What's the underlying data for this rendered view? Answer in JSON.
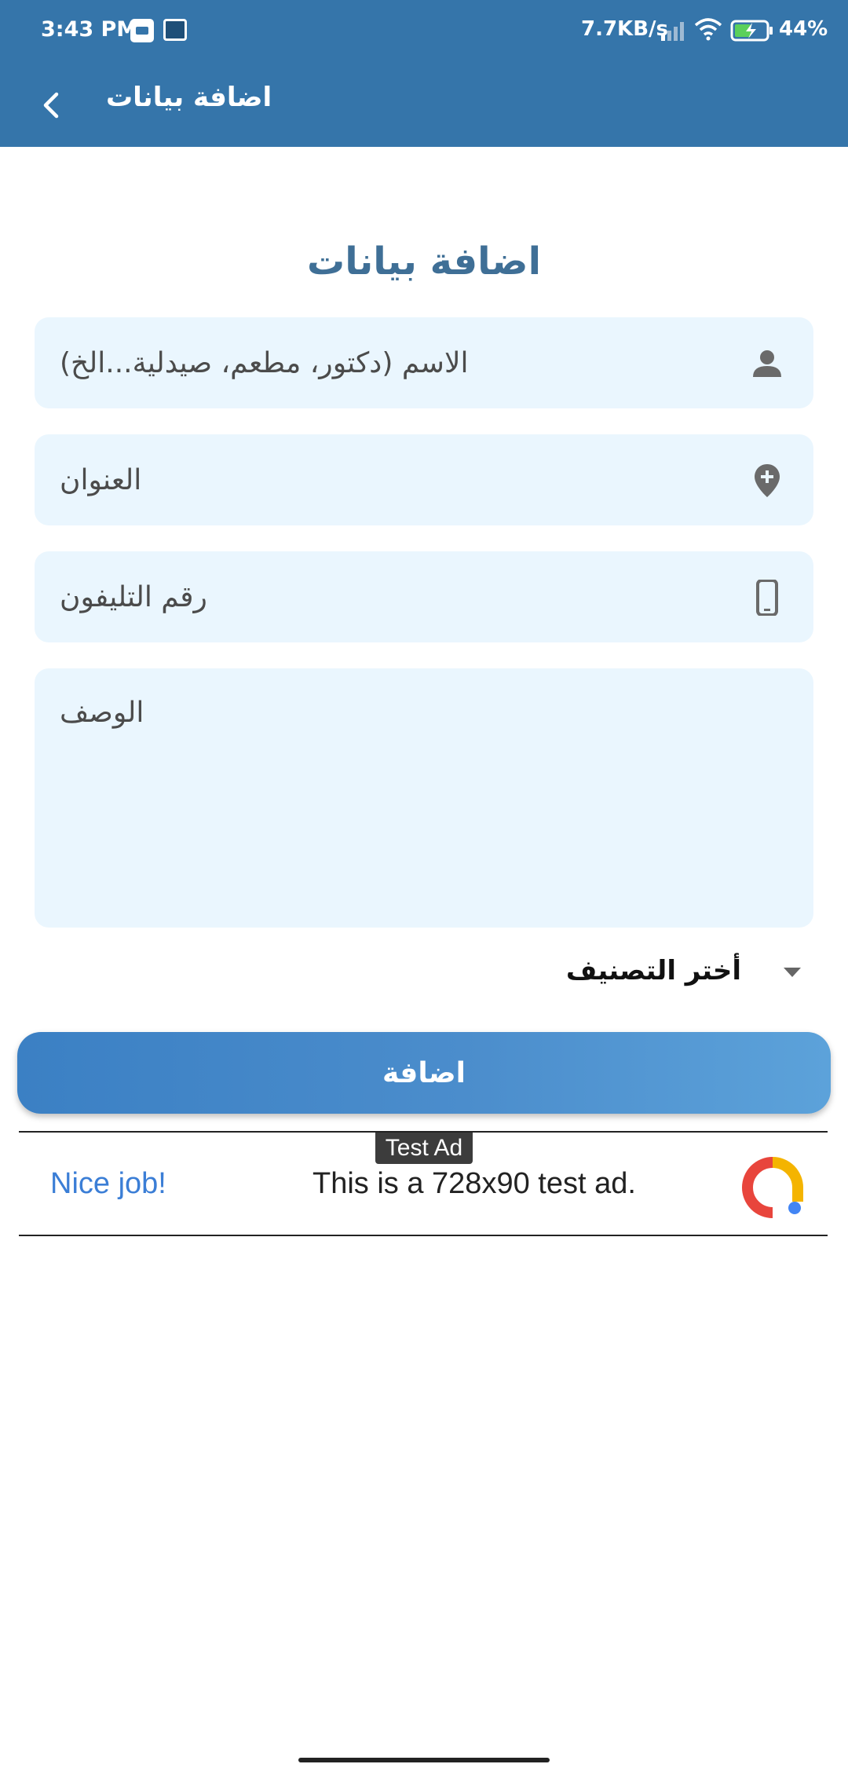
{
  "status_bar": {
    "time": "3:43 PM",
    "speed": "7.7KB/s",
    "battery": "44%",
    "icons": [
      "notification-app-icon",
      "notification-tv-icon",
      "signal-icon",
      "wifi-icon",
      "battery-icon"
    ]
  },
  "app_bar": {
    "title": "اضافة بيانات",
    "back_icon": "chevron-left-icon"
  },
  "form": {
    "title": "اضافة بيانات",
    "name_placeholder": "الاسم (دكتور، مطعم، صيدلية...الخ)",
    "address_placeholder": "العنوان",
    "phone_placeholder": "رقم التليفون",
    "description_placeholder": "الوصف",
    "category_label": "أختر التصنيف",
    "submit_label": "اضافة"
  },
  "ad": {
    "tag": "Test Ad",
    "nice": "Nice job!",
    "text": "This is a 728x90 test ad."
  },
  "colors": {
    "primary": "#3575aa",
    "field_bg": "#eaf6fe",
    "title": "#3f6f96",
    "button": "#4b8dcc"
  }
}
